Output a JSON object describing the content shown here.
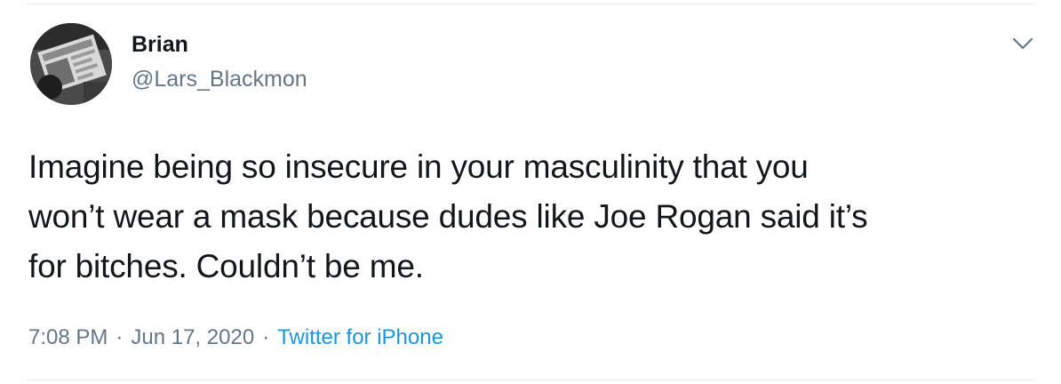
{
  "author": {
    "display_name": "Brian",
    "handle": "@Lars_Blackmon",
    "avatar_icon": "profile-photo"
  },
  "menu": {
    "caret_icon": "chevron-down-icon"
  },
  "tweet": {
    "text_lines": [
      "Imagine being so insecure in your masculinity that you",
      "won’t wear a mask because dudes like Joe Rogan said it’s",
      "for bitches. Couldn’t be me."
    ]
  },
  "meta": {
    "time": "7:08 PM",
    "separator": "·",
    "date": "Jun 17, 2020",
    "source": "Twitter for iPhone"
  },
  "colors": {
    "text": "#14171a",
    "muted": "#657786",
    "link": "#1b95e0",
    "divider": "#e6ecf0"
  }
}
